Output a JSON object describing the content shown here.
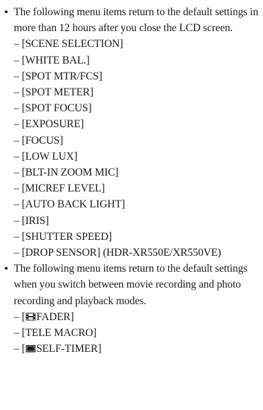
{
  "section1": {
    "bullet": "•",
    "text": "The following menu items return to the default settings in more than 12 hours after you close the LCD screen.",
    "items": [
      {
        "prefix": "– ",
        "label": "[SCENE SELECTION]"
      },
      {
        "prefix": "– ",
        "label": "[WHITE BAL.]"
      },
      {
        "prefix": "– ",
        "label": "[SPOT MTR/FCS]"
      },
      {
        "prefix": "– ",
        "label": "[SPOT METER]"
      },
      {
        "prefix": "– ",
        "label": "[SPOT FOCUS]"
      },
      {
        "prefix": "– ",
        "label": "[EXPOSURE]"
      },
      {
        "prefix": "– ",
        "label": "[FOCUS]"
      },
      {
        "prefix": "– ",
        "label": "[LOW LUX]"
      },
      {
        "prefix": "– ",
        "label": "[BLT-IN ZOOM MIC]"
      },
      {
        "prefix": "– ",
        "label": "[MICREF LEVEL]"
      },
      {
        "prefix": "– ",
        "label": "[AUTO BACK LIGHT]"
      },
      {
        "prefix": "– ",
        "label": "[IRIS]"
      },
      {
        "prefix": "– ",
        "label": "[SHUTTER SPEED]"
      },
      {
        "prefix": "– ",
        "label": "[DROP SENSOR]  (HDR-XR550E/XR550VE)"
      }
    ]
  },
  "section2": {
    "bullet": "•",
    "text": "The following menu items return to the default settings when you switch between movie recording and photo recording and playback modes.",
    "items": [
      {
        "prefix": "– [",
        "icon": "movie-film-icon",
        "label": "FADER]"
      },
      {
        "prefix": "– ",
        "label": "[TELE MACRO]"
      },
      {
        "prefix": "– [",
        "icon": "camera-icon",
        "label": "SELF-TIMER]"
      }
    ]
  }
}
